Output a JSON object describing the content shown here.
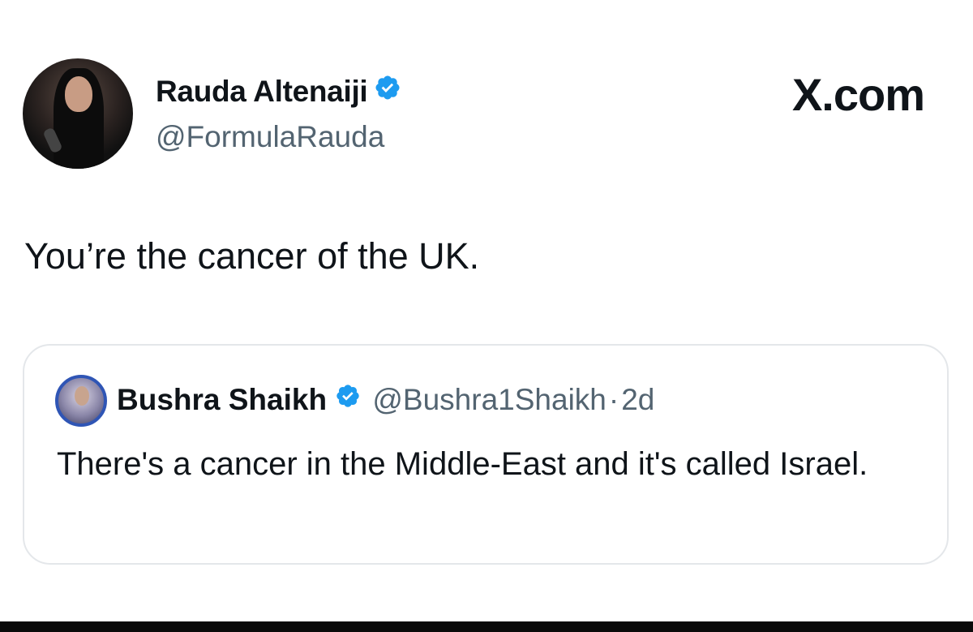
{
  "author": {
    "display_name": "Rauda Altenaiji",
    "handle": "@FormulaRauda",
    "verified": true
  },
  "brand": {
    "label": "X.com"
  },
  "tweet": {
    "text": "You’re the cancer of the UK."
  },
  "quoted_tweet": {
    "display_name": "Bushra Shaikh",
    "handle": "@Bushra1Shaikh",
    "separator": "·",
    "time": "2d",
    "verified": true,
    "text": "There's a cancer in the Middle-East and it's called Israel."
  },
  "colors": {
    "verified_blue": "#1d9bf0",
    "secondary_text": "#536471",
    "quote_border": "#e4e7ea"
  },
  "icons": {
    "verified": "verified-badge-icon"
  }
}
